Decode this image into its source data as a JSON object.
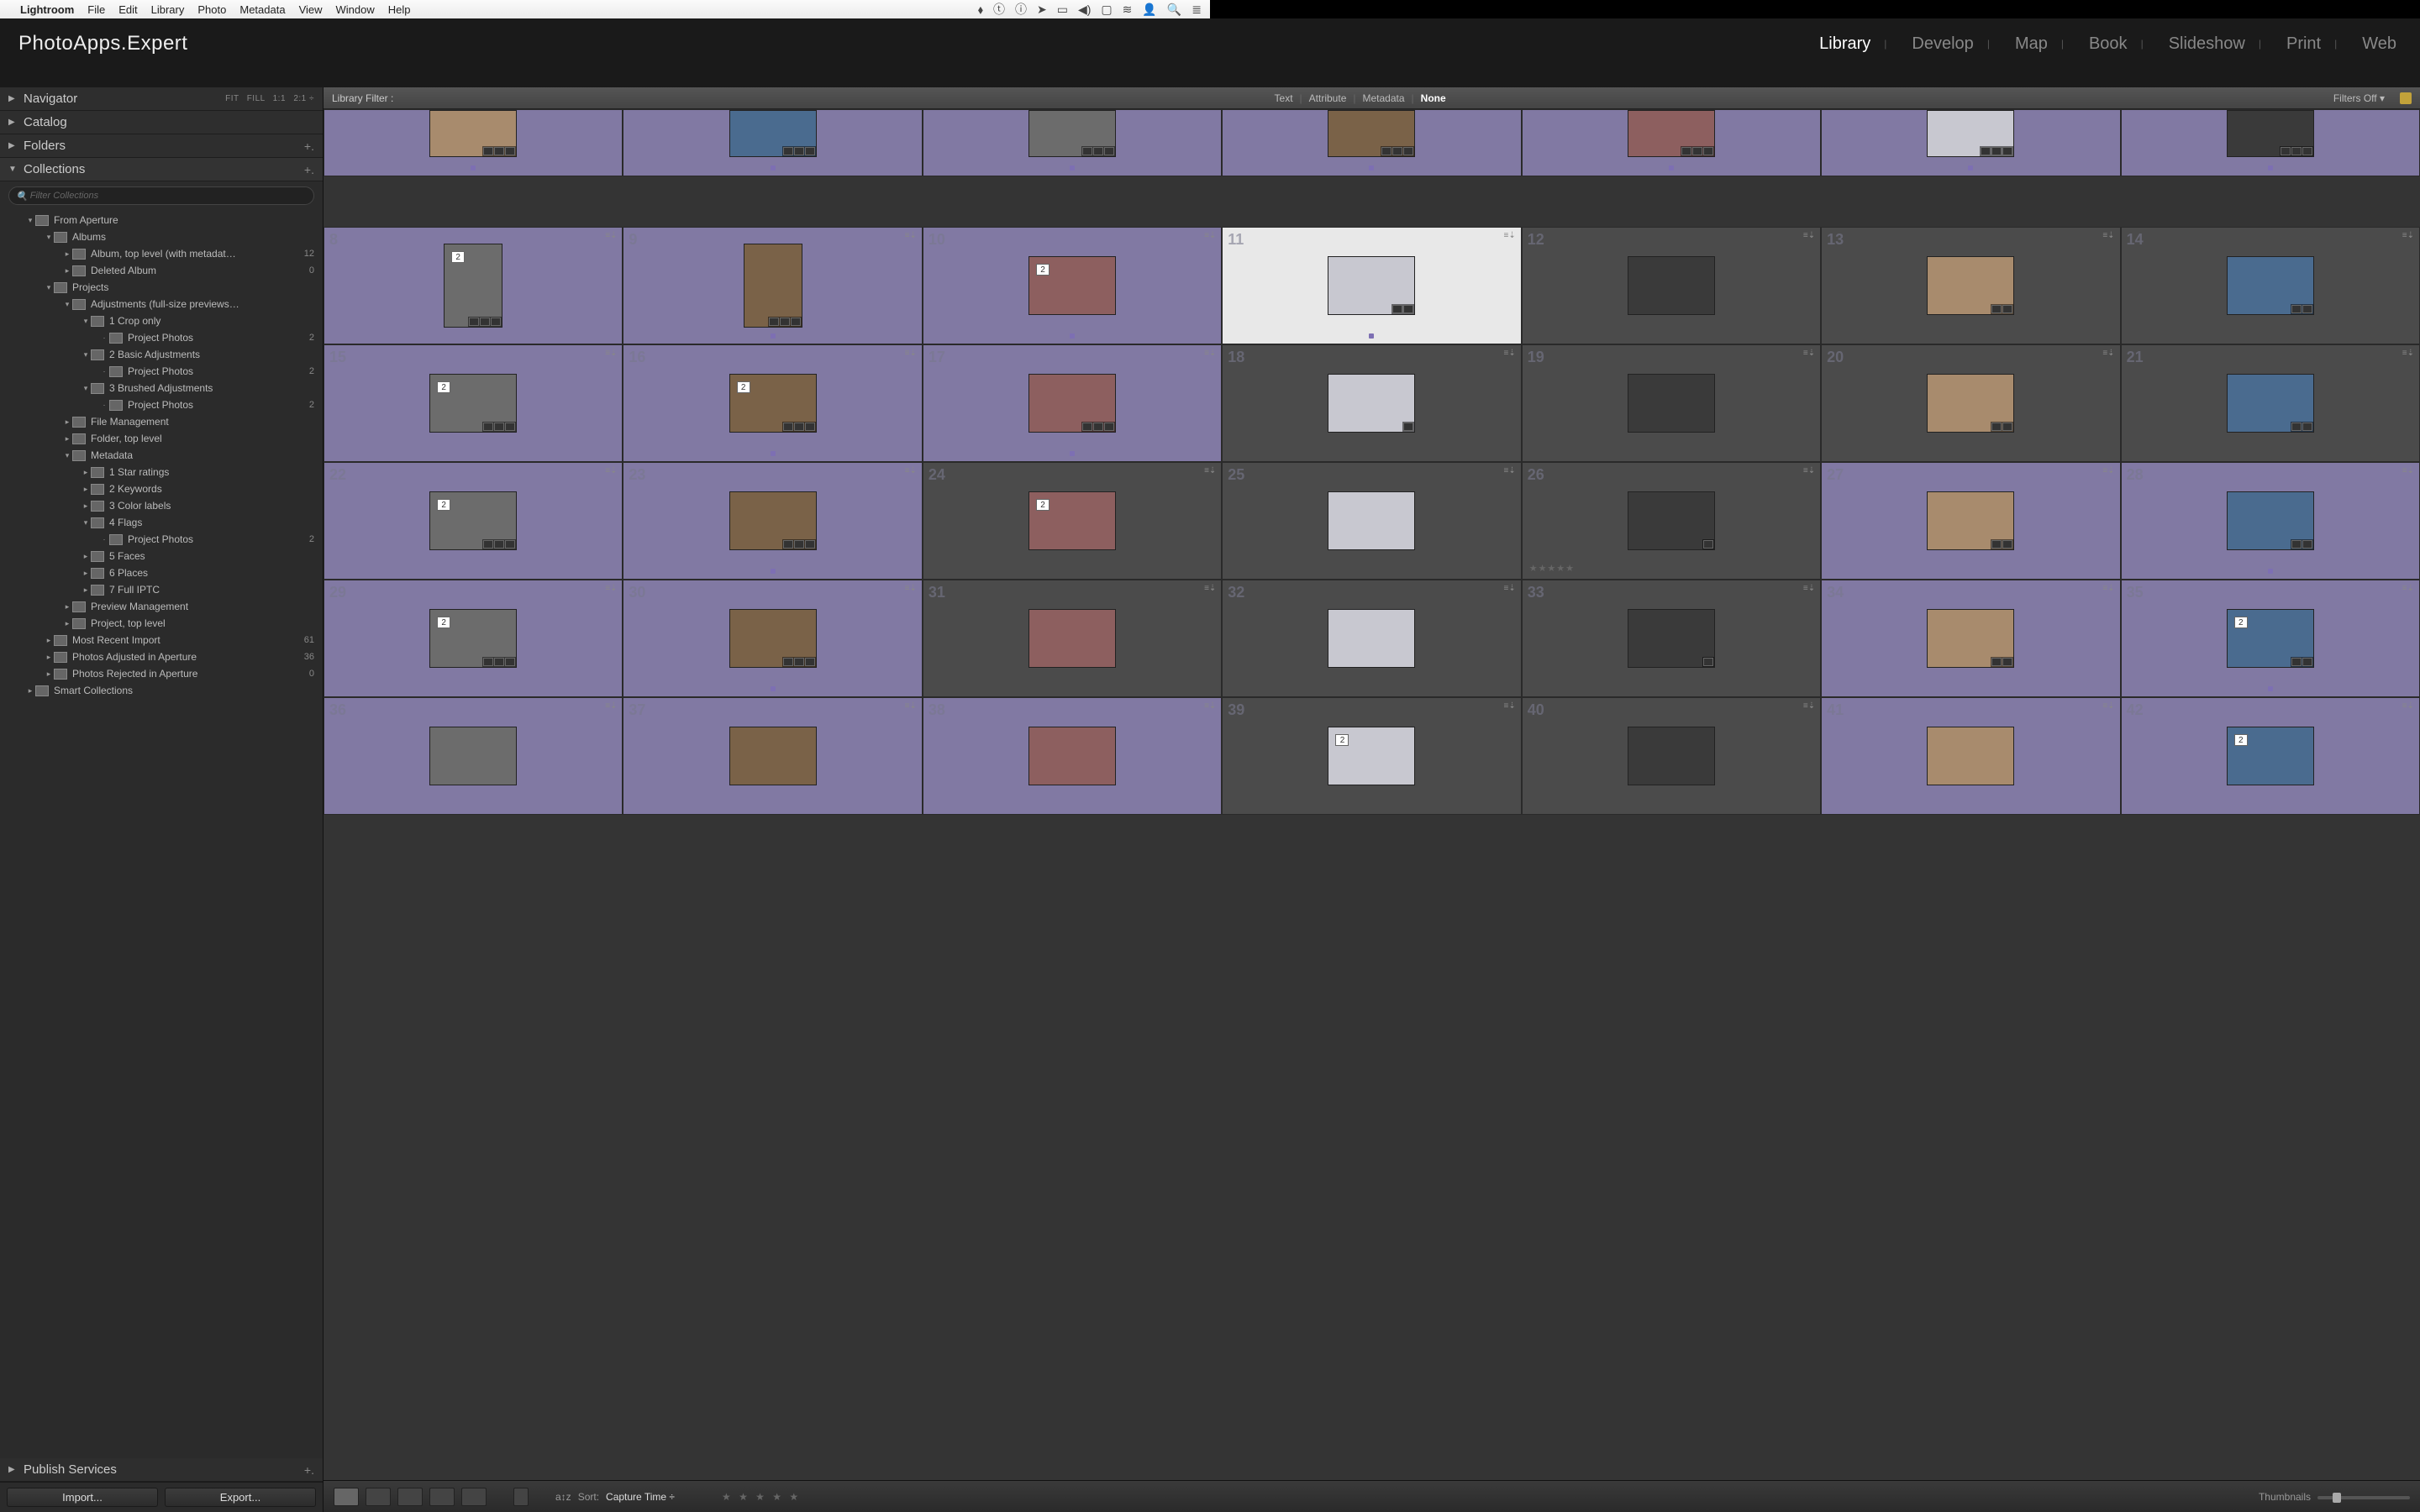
{
  "menubar": {
    "app": "Lightroom",
    "items": [
      "File",
      "Edit",
      "Library",
      "Photo",
      "Metadata",
      "View",
      "Window",
      "Help"
    ]
  },
  "brand": "PhotoApps.Expert",
  "modules": [
    "Library",
    "Develop",
    "Map",
    "Book",
    "Slideshow",
    "Print",
    "Web"
  ],
  "active_module": "Library",
  "left": {
    "navigator": {
      "label": "Navigator",
      "opts": [
        "FIT",
        "FILL",
        "1:1",
        "2:1"
      ]
    },
    "panels": [
      {
        "label": "Catalog"
      },
      {
        "label": "Folders",
        "plus": true
      }
    ],
    "collections_label": "Collections",
    "filter_placeholder": "Filter Collections",
    "tree": [
      {
        "d": 0,
        "disc": "▾",
        "nm": "From Aperture"
      },
      {
        "d": 1,
        "disc": "▾",
        "nm": "Albums"
      },
      {
        "d": 2,
        "disc": "▸",
        "nm": "Album, top level (with metadat…",
        "ct": "12"
      },
      {
        "d": 2,
        "disc": "▸",
        "nm": "Deleted Album",
        "ct": "0"
      },
      {
        "d": 1,
        "disc": "▾",
        "nm": "Projects"
      },
      {
        "d": 2,
        "disc": "▾",
        "nm": "Adjustments (full-size previews…"
      },
      {
        "d": 3,
        "disc": "▾",
        "nm": "1 Crop only"
      },
      {
        "d": 4,
        "disc": "",
        "nm": "Project Photos",
        "ct": "2"
      },
      {
        "d": 3,
        "disc": "▾",
        "nm": "2 Basic Adjustments"
      },
      {
        "d": 4,
        "disc": "",
        "nm": "Project Photos",
        "ct": "2"
      },
      {
        "d": 3,
        "disc": "▾",
        "nm": "3 Brushed Adjustments"
      },
      {
        "d": 4,
        "disc": "",
        "nm": "Project Photos",
        "ct": "2"
      },
      {
        "d": 2,
        "disc": "▸",
        "nm": "File Management"
      },
      {
        "d": 2,
        "disc": "▸",
        "nm": "Folder, top level"
      },
      {
        "d": 2,
        "disc": "▾",
        "nm": "Metadata"
      },
      {
        "d": 3,
        "disc": "▸",
        "nm": "1 Star ratings"
      },
      {
        "d": 3,
        "disc": "▸",
        "nm": "2 Keywords"
      },
      {
        "d": 3,
        "disc": "▸",
        "nm": "3 Color labels"
      },
      {
        "d": 3,
        "disc": "▾",
        "nm": "4 Flags"
      },
      {
        "d": 4,
        "disc": "",
        "nm": "Project Photos",
        "ct": "2"
      },
      {
        "d": 3,
        "disc": "▸",
        "nm": "5 Faces"
      },
      {
        "d": 3,
        "disc": "▸",
        "nm": "6 Places"
      },
      {
        "d": 3,
        "disc": "▸",
        "nm": "7 Full IPTC"
      },
      {
        "d": 2,
        "disc": "▸",
        "nm": "Preview Management"
      },
      {
        "d": 2,
        "disc": "▸",
        "nm": "Project, top level"
      },
      {
        "d": 1,
        "disc": "▸",
        "nm": "Most Recent Import",
        "ct": "61"
      },
      {
        "d": 1,
        "disc": "▸",
        "nm": "Photos Adjusted in Aperture",
        "ct": "36"
      },
      {
        "d": 1,
        "disc": "▸",
        "nm": "Photos Rejected in Aperture",
        "ct": "0"
      },
      {
        "d": 0,
        "disc": "▸",
        "nm": "Smart Collections"
      }
    ],
    "publish_label": "Publish Services",
    "import_label": "Import...",
    "export_label": "Export..."
  },
  "filterbar": {
    "label": "Library Filter :",
    "tabs": [
      "Text",
      "Attribute",
      "Metadata",
      "None"
    ],
    "active": "None",
    "filters_off": "Filters Off"
  },
  "grid": {
    "start_row_partial": [
      {
        "n": "",
        "sel": true
      },
      {
        "n": "",
        "sel": true
      },
      {
        "n": "",
        "sel": true,
        "stack": ""
      },
      {
        "n": "",
        "sel": true
      },
      {
        "n": "",
        "sel": true
      },
      {
        "n": "",
        "sel": true
      },
      {
        "n": "",
        "sel": true
      }
    ],
    "cells": [
      {
        "n": 8,
        "sel": true,
        "port": true,
        "stack": 2,
        "badges": 3
      },
      {
        "n": 9,
        "sel": true,
        "port": true,
        "badges": 3,
        "dot": true
      },
      {
        "n": 10,
        "sel": true,
        "stack": 2,
        "dot": true
      },
      {
        "n": 11,
        "cur": true,
        "badges": 2,
        "dot": true
      },
      {
        "n": 12,
        "sel": false
      },
      {
        "n": 13,
        "sel": false,
        "badges": 2
      },
      {
        "n": 14,
        "sel": false,
        "badges": 2
      },
      {
        "n": 15,
        "sel": true,
        "stack": 2,
        "badges": 3
      },
      {
        "n": 16,
        "sel": true,
        "stack": 2,
        "badges": 3,
        "dot": true
      },
      {
        "n": 17,
        "sel": true,
        "badges": 3,
        "dot": true
      },
      {
        "n": 18,
        "sel": false,
        "badges": 1
      },
      {
        "n": 19,
        "sel": false
      },
      {
        "n": 20,
        "sel": false,
        "badges": 2
      },
      {
        "n": 21,
        "sel": false,
        "badges": 2
      },
      {
        "n": 22,
        "sel": true,
        "stack": 2,
        "badges": 3
      },
      {
        "n": 23,
        "sel": true,
        "badges": 3,
        "dot": true
      },
      {
        "n": 24,
        "sel": false,
        "stack": 2
      },
      {
        "n": 25,
        "sel": false
      },
      {
        "n": 26,
        "sel": false,
        "stars": "★★★★★",
        "badges": 1
      },
      {
        "n": 27,
        "sel": true,
        "badges": 2
      },
      {
        "n": 28,
        "sel": true,
        "badges": 2,
        "dot": true
      },
      {
        "n": 29,
        "sel": true,
        "stack": 2,
        "badges": 3
      },
      {
        "n": 30,
        "sel": true,
        "badges": 3,
        "dot": true
      },
      {
        "n": 31,
        "sel": false
      },
      {
        "n": 32,
        "sel": false
      },
      {
        "n": 33,
        "sel": false,
        "badges": 1
      },
      {
        "n": 34,
        "sel": true,
        "badges": 2
      },
      {
        "n": 35,
        "sel": true,
        "stack": 2,
        "badges": 2,
        "dot": true
      },
      {
        "n": 36,
        "sel": true
      },
      {
        "n": 37,
        "sel": true
      },
      {
        "n": 38,
        "sel": true
      },
      {
        "n": 39,
        "sel": false,
        "stack": 2
      },
      {
        "n": 40,
        "sel": false
      },
      {
        "n": 41,
        "sel": true
      },
      {
        "n": 42,
        "sel": true,
        "stack": 2
      }
    ]
  },
  "toolbar": {
    "sort_label": "Sort:",
    "sort_value": "Capture Time",
    "thumbs_label": "Thumbnails"
  },
  "thumb_tones": [
    "#a88b6d",
    "#4a6b8f",
    "#6c6c6c",
    "#7a6248",
    "#8d5f5f",
    "#c8c8d0",
    "#3a3a3a"
  ]
}
